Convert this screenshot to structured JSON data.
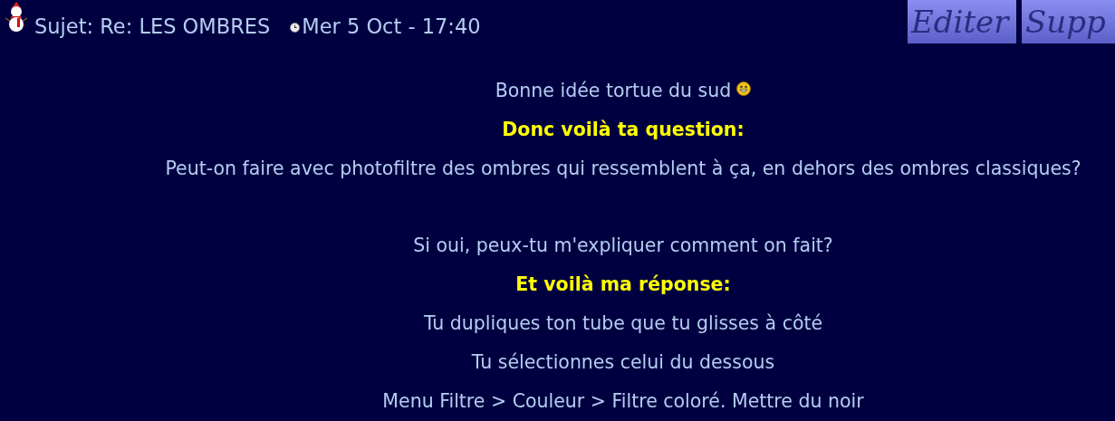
{
  "post_header": {
    "subject": "Sujet: Re: LES OMBRES",
    "date": "Mer 5 Oct - 17:40"
  },
  "buttons": [
    "Editer",
    "Supp"
  ],
  "paragraphs": [
    {
      "lines": [
        {
          "kind": "plain",
          "text": "Bonne idée tortue du sud",
          "smiley": true
        },
        {
          "kind": "heading",
          "text": "Donc voilà ta question:",
          "smiley": false
        },
        {
          "kind": "plain",
          "text": "Peut-on faire avec photofiltre des ombres qui ressemblent à ça, en dehors des ombres classiques?",
          "smiley": false
        }
      ]
    },
    {
      "lines": [
        {
          "kind": "plain",
          "text": "Si oui, peux-tu m'expliquer comment on fait?",
          "smiley": false
        },
        {
          "kind": "heading",
          "text": "Et voilà ma réponse:",
          "smiley": false
        },
        {
          "kind": "plain",
          "text": "Tu dupliques ton tube que tu glisses à côté",
          "smiley": false
        },
        {
          "kind": "plain",
          "text": "Tu sélectionnes celui du dessous",
          "smiley": false
        },
        {
          "kind": "plain",
          "text": "Menu Filtre > Couleur > Filtre coloré. Mettre du noir",
          "smiley": false
        }
      ]
    }
  ]
}
